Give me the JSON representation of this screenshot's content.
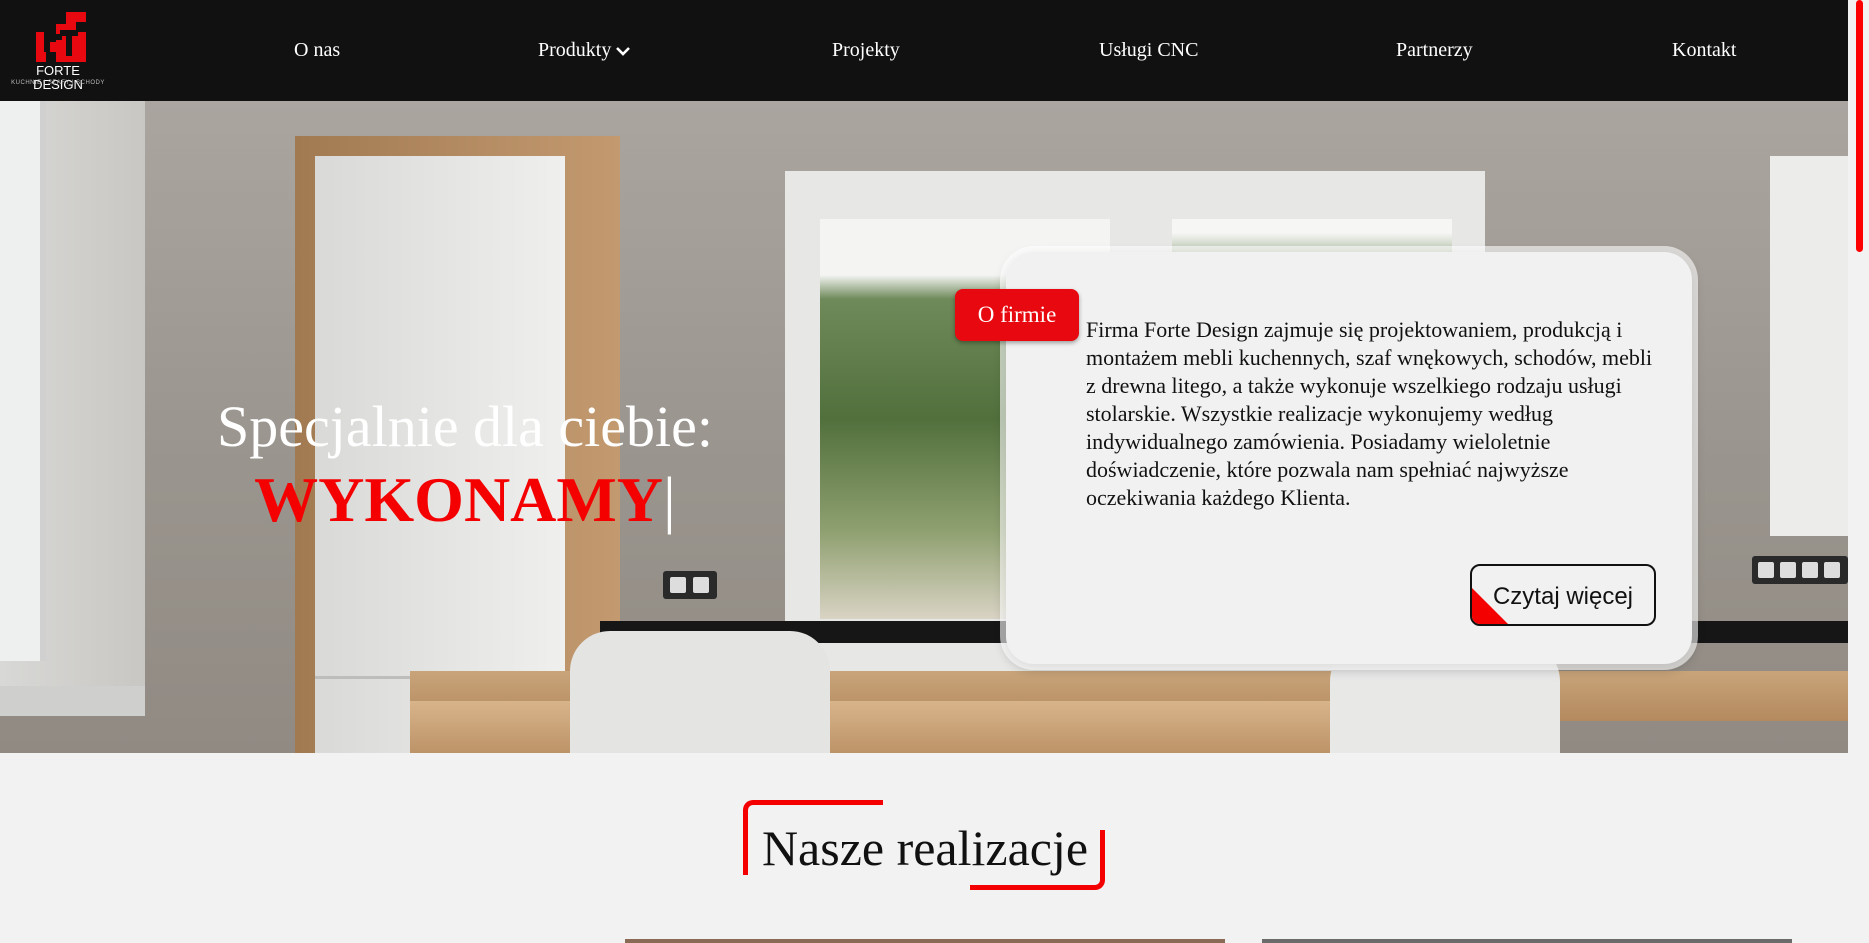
{
  "brand": {
    "name": "FORTE DESIGN",
    "tagline": "KUCHNIE | SZAFY | SCHODY",
    "logo_color": "#e8080f"
  },
  "nav": {
    "items": [
      {
        "label": "O nas"
      },
      {
        "label": "Produkty",
        "has_dropdown": true
      },
      {
        "label": "Projekty"
      },
      {
        "label": "Usługi CNC"
      },
      {
        "label": "Partnerzy"
      },
      {
        "label": "Kontakt"
      }
    ],
    "background": "#111111"
  },
  "hero": {
    "title": "Specjalnie dla ciebie:",
    "word": "WYKONAMY",
    "caret": "|",
    "accent": "#f40000"
  },
  "about": {
    "badge": "O firmie",
    "text": "Firma Forte Design zajmuje się projektowaniem, produkcją i montażem mebli kuchennych, szaf wnękowych, schodów, mebli z drewna litego, a także wykonuje wszelkiego rodzaju usługi stolarskie. Wszystkie realizacje wykonujemy według indywidualnego zamówienia. Posiadamy wieloletnie doświadczenie, które pozwala nam spełniać najwyższe oczekiwania każdego Klienta.",
    "button": "Czytaj więcej"
  },
  "section": {
    "title": "Nasze realizacje"
  },
  "scroll_position": 0
}
